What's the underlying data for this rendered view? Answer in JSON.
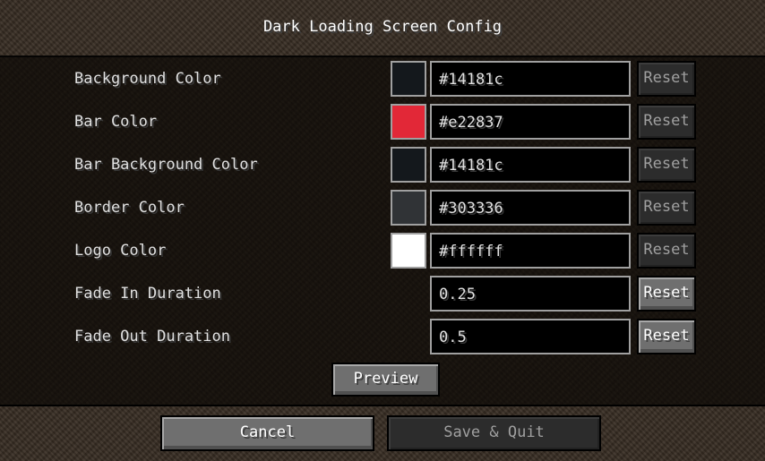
{
  "title": "Dark Loading Screen Config",
  "rows": [
    {
      "label": "Background Color",
      "value": "#14181c",
      "swatch": "#14181c",
      "reset_label": "Reset",
      "reset_enabled": false
    },
    {
      "label": "Bar Color",
      "value": "#e22837",
      "swatch": "#e22837",
      "reset_label": "Reset",
      "reset_enabled": false
    },
    {
      "label": "Bar Background Color",
      "value": "#14181c",
      "swatch": "#14181c",
      "reset_label": "Reset",
      "reset_enabled": false
    },
    {
      "label": "Border Color",
      "value": "#303336",
      "swatch": "#303336",
      "reset_label": "Reset",
      "reset_enabled": false
    },
    {
      "label": "Logo Color",
      "value": "#ffffff",
      "swatch": "#ffffff",
      "reset_label": "Reset",
      "reset_enabled": false
    },
    {
      "label": "Fade In Duration",
      "value": "0.25",
      "reset_label": "Reset",
      "reset_enabled": true
    },
    {
      "label": "Fade Out Duration",
      "value": "0.5",
      "reset_label": "Reset",
      "reset_enabled": true
    }
  ],
  "preview_label": "Preview",
  "footer": {
    "cancel_label": "Cancel",
    "save_label": "Save & Quit",
    "save_enabled": false
  }
}
